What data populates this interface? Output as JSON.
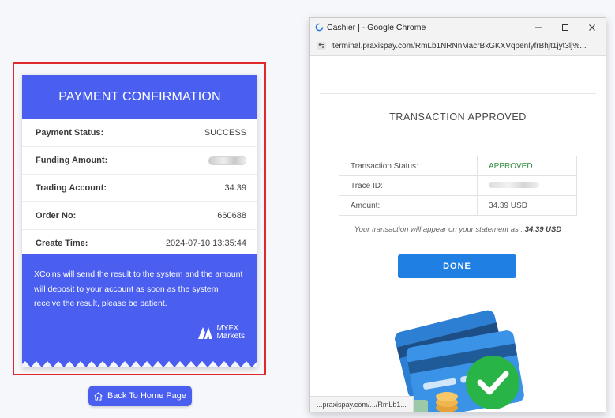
{
  "receipt": {
    "header_title": "PAYMENT CONFIRMATION",
    "rows": [
      {
        "label": "Payment Status:",
        "value": "SUCCESS"
      },
      {
        "label": "Funding Amount:",
        "value": ""
      },
      {
        "label": "Trading Account:",
        "value": "34.39"
      },
      {
        "label": "Order No:",
        "value": "660688"
      },
      {
        "label": "Create Time:",
        "value": "2024-07-10 13:35:44"
      }
    ],
    "message": "XCoins will send the result to the system and the amount will deposit to your account as soon as the system receive the result, please be patient.",
    "brand_line1": "MYFX",
    "brand_line2": "Markets"
  },
  "home_button": {
    "label": "Back To Home Page",
    "icon": "home-icon"
  },
  "browser": {
    "window_title": "Cashier | - Google Chrome",
    "url": "terminal.praxispay.com/RmLb1NRNnMacrBkGKXVqpenlyfrBhjt1jyt3lj%...",
    "status_url": "...praxispay.com/.../RmLb1..."
  },
  "cashier": {
    "title": "TRANSACTION APPROVED",
    "rows": [
      {
        "label": "Transaction Status:",
        "value": "APPROVED"
      },
      {
        "label": "Trace ID:",
        "value": ""
      },
      {
        "label": "Amount:",
        "value": "34.39 USD"
      }
    ],
    "note_prefix": "Your transaction will appear on your statement as : ",
    "note_amount": "34.39 USD",
    "done_label": "DONE"
  },
  "colors": {
    "brand_blue": "#4a5ff0",
    "highlight_red": "#e0282d",
    "done_blue": "#1f7fe3",
    "approved_green": "#2e8a3e",
    "check_green": "#28b446"
  }
}
